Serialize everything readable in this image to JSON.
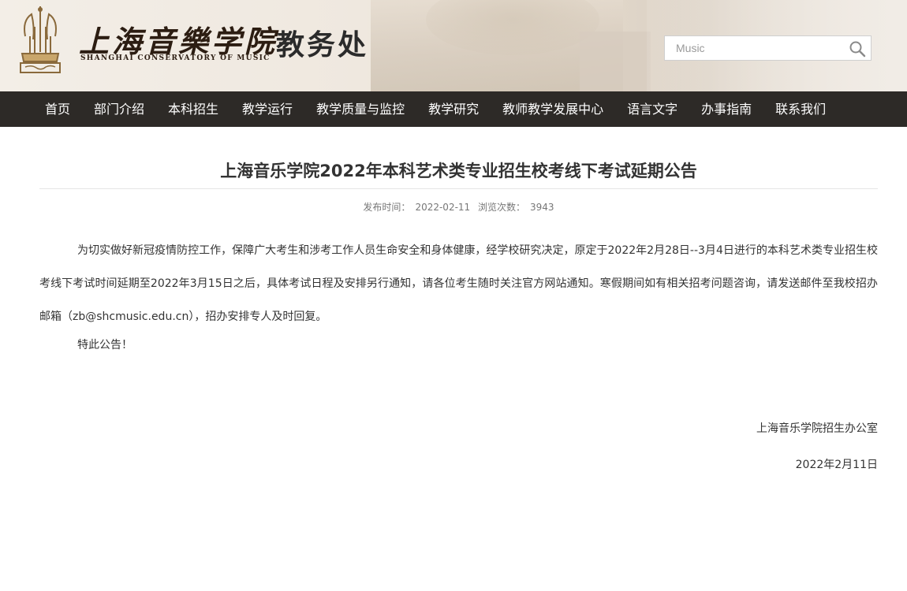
{
  "header": {
    "logo_cn": "上海音樂学院",
    "logo_en": "SHANGHAI CONSERVATORY OF MUSIC",
    "office_name": "教务处",
    "search_placeholder": "Music"
  },
  "nav": {
    "items": [
      "首页",
      "部门介绍",
      "本科招生",
      "教学运行",
      "教学质量与监控",
      "教学研究",
      "教师教学发展中心",
      "语言文字",
      "办事指南",
      "联系我们"
    ]
  },
  "article": {
    "title": "上海音乐学院2022年本科艺术类专业招生校考线下考试延期公告",
    "publish_label": "发布时间：",
    "publish_date": "2022-02-11",
    "views_label": "浏览次数：",
    "views_count": "3943",
    "body": "为切实做好新冠疫情防控工作，保障广大考生和涉考工作人员生命安全和身体健康，经学校研究决定，原定于2022年2月28日--3月4日进行的本科艺术类专业招生校考线下考试时间延期至2022年3月15日之后，具体考试日程及安排另行通知，请各位考生随时关注官方网站通知。寒假期间如有相关招考问题咨询，请发送邮件至我校招办邮箱（zb@shcmusic.edu.cn），招办安排专人及时回复。",
    "closing": "特此公告！",
    "signature": "上海音乐学院招生办公室",
    "date": "2022年2月11日"
  },
  "colors": {
    "nav_bg": "#2d2a27",
    "nav_text": "#ffffff",
    "header_bg": "#efe8df"
  }
}
